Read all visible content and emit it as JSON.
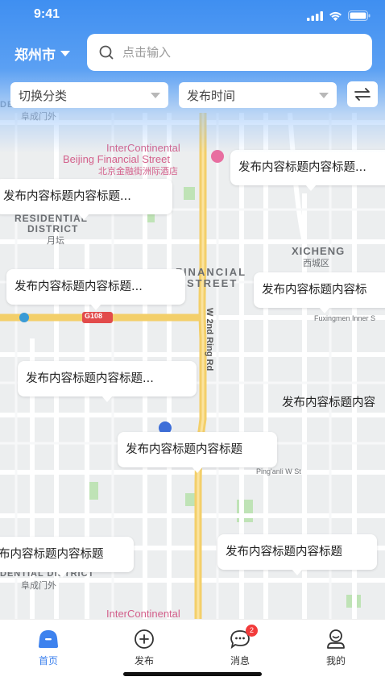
{
  "status": {
    "time": "9:41"
  },
  "header": {
    "city": "郑州市",
    "search_placeholder": "点击输入"
  },
  "filters": {
    "category": "切换分类",
    "time": "发布时间"
  },
  "bubbles": [
    "发布内容标题内容标题...",
    "发布内容标题内容标题...",
    "发布内容标题内容标题...",
    "发布内容标题内容标",
    "发布内容标题内容标题...",
    "发布内容标题内容",
    "发布内容标题内容标题",
    "布内容标题内容标题",
    "发布内容标题内容标题"
  ],
  "map_labels": {
    "district_top": "DENTIAL DISTRICT",
    "fucheng_top": "阜成门外",
    "intercontinental": "InterContinental",
    "beijing_financial": "Beijing Financial Street",
    "financial_cn": "北京金融街洲际酒店",
    "residential": "RESIDENTIAL",
    "district": "DISTRICT",
    "yuetan": "月坛",
    "xicheng": "XICHENG",
    "xicheng_cn": "西城区",
    "financial": "FINANCIAL",
    "street": "STREET",
    "g108": "G108",
    "ring_rd": "W 2nd Ring Rd",
    "fuxingmen": "Fuxingmen Inner S",
    "pinganli": "Ping'anli W St",
    "district_bottom": "DENTIAL DISTRICT",
    "fucheng_bottom": "阜成门外",
    "intercontinental_bottom": "InterContinental"
  },
  "tabs": [
    {
      "label": "首页"
    },
    {
      "label": "发布"
    },
    {
      "label": "消息",
      "badge": "2"
    },
    {
      "label": "我的"
    }
  ],
  "colors": {
    "accent": "#3d82ee",
    "badge": "#f23b3b",
    "road_major": "#f5d67a"
  }
}
